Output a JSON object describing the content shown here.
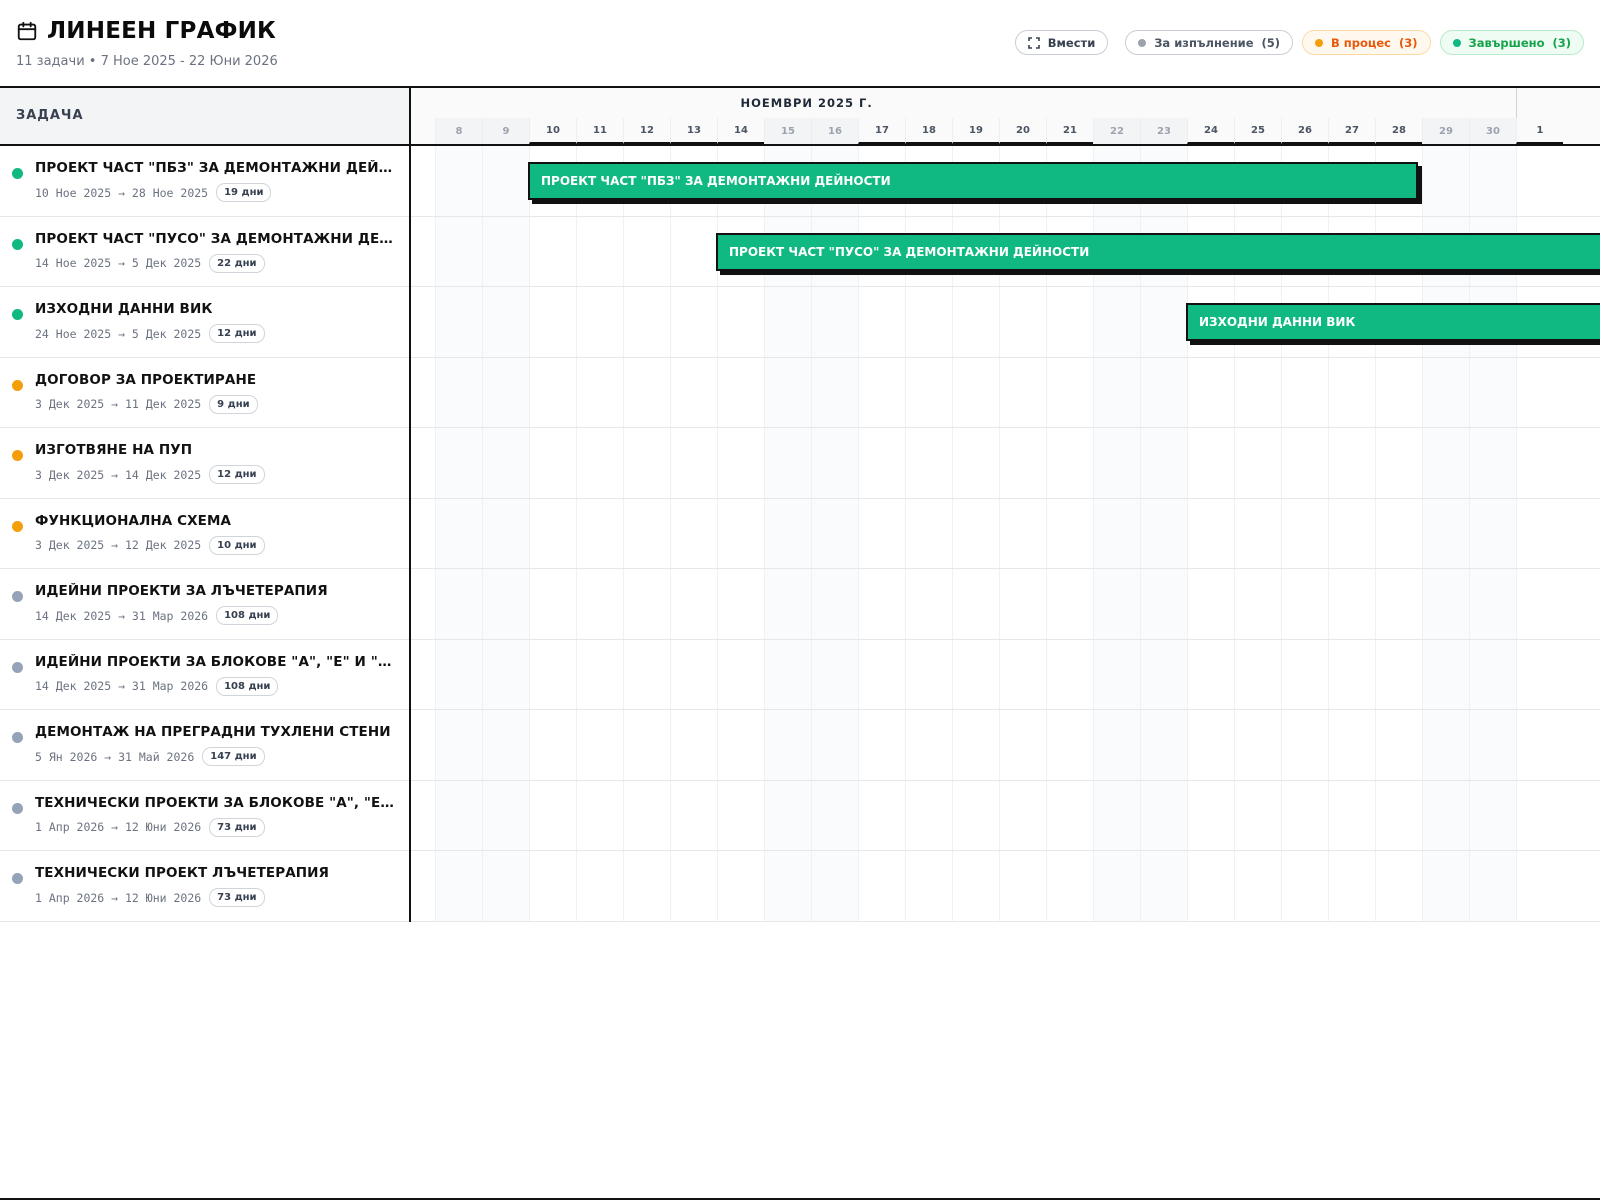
{
  "header": {
    "title": "ЛИНЕЕН ГРАФИК",
    "subtitle": "11 задачи • 7 Ное 2025 - 22 Юни 2026",
    "calendar_icon": "calendar-icon"
  },
  "controls": {
    "fit_label": "Вмести",
    "fit_icon": "fit-screen-icon",
    "filters": [
      {
        "label": "За изпълнение",
        "count": "(5)",
        "color": "#9ca3af"
      },
      {
        "label": "В процес",
        "count": "(3)",
        "color": "#f59e0b"
      },
      {
        "label": "Завършено",
        "count": "(3)",
        "color": "#10b981"
      }
    ]
  },
  "columns": {
    "task_header": "ЗАДАЧА"
  },
  "timeline": {
    "months": [
      "НОЕМВРИ 2025 Г."
    ],
    "days": [
      "8",
      "9",
      "10",
      "11",
      "12",
      "13",
      "14",
      "15",
      "16",
      "17",
      "18",
      "19",
      "20",
      "21",
      "22",
      "23",
      "24",
      "25",
      "26",
      "27",
      "28",
      "29",
      "30",
      "1"
    ]
  },
  "tasks": [
    {
      "name": "ПРОЕКТ ЧАСТ \"ПБЗ\" ЗА ДЕМОНТАЖНИ ДЕЙНОСТИ",
      "dates": "10 Ное 2025 → 28 Ное 2025",
      "duration": "19 дни",
      "status": "done"
    },
    {
      "name": "ПРОЕКТ ЧАСТ \"ПУСО\" ЗА ДЕМОНТАЖНИ ДЕЙНОСТИ",
      "dates": "14 Ное 2025 → 5 Дек 2025",
      "duration": "22 дни",
      "status": "done"
    },
    {
      "name": "ИЗХОДНИ ДАННИ ВИК",
      "dates": "24 Ное 2025 → 5 Дек 2025",
      "duration": "12 дни",
      "status": "done"
    },
    {
      "name": "ДОГОВОР ЗА ПРОЕКТИРАНЕ",
      "dates": "3 Дек 2025 → 11 Дек 2025",
      "duration": "9 дни",
      "status": "inprogress"
    },
    {
      "name": "ИЗГОТВЯНЕ НА ПУП",
      "dates": "3 Дек 2025 → 14 Дек 2025",
      "duration": "12 дни",
      "status": "inprogress"
    },
    {
      "name": "ФУНКЦИОНАЛНА СХЕМА",
      "dates": "3 Дек 2025 → 12 Дек 2025",
      "duration": "10 дни",
      "status": "inprogress"
    },
    {
      "name": "ИДЕЙНИ ПРОЕКТИ ЗА ЛЪЧЕТЕРАПИЯ",
      "dates": "14 Дек 2025 → 31 Мар 2026",
      "duration": "108 дни",
      "status": "todo"
    },
    {
      "name": "ИДЕЙНИ ПРОЕКТИ ЗА БЛОКОВЕ \"А\", \"Е\" И \"К\"",
      "dates": "14 Дек 2025 → 31 Мар 2026",
      "duration": "108 дни",
      "status": "todo"
    },
    {
      "name": "ДЕМОНТАЖ НА ПРЕГРАДНИ ТУХЛЕНИ СТЕНИ",
      "dates": "5 Ян 2026 → 31 Май 2026",
      "duration": "147 дни",
      "status": "todo"
    },
    {
      "name": "ТЕХНИЧЕСКИ ПРОЕКТИ ЗА БЛОКОВЕ \"А\", \"Е\" И \"К\"",
      "dates": "1 Апр 2026 → 12 Юни 2026",
      "duration": "73 дни",
      "status": "todo"
    },
    {
      "name": "ТЕХНИЧЕСКИ ПРОЕКТ ЛЪЧЕТЕРАПИЯ",
      "dates": "1 Апр 2026 → 12 Юни 2026",
      "duration": "73 дни",
      "status": "todo"
    }
  ],
  "bars": [
    {
      "label": "ПРОЕКТ ЧАСТ \"ПБЗ\" ЗА ДЕМОНТАЖНИ ДЕЙНОСТИ",
      "start_day": "10",
      "end_day": "28",
      "row": 0
    },
    {
      "label": "ПРОЕКТ ЧАСТ \"ПУСО\" ЗА ДЕМОНТАЖНИ ДЕЙНОСТИ",
      "start_day": "14",
      "end_day": "",
      "row": 1
    },
    {
      "label": "ИЗХОДНИ ДАННИ ВИК",
      "start_day": "24",
      "end_day": "",
      "row": 2
    }
  ],
  "status_colors": {
    "done": "#10b981",
    "inprogress": "#f59e0b",
    "todo": "#94a3b8"
  }
}
